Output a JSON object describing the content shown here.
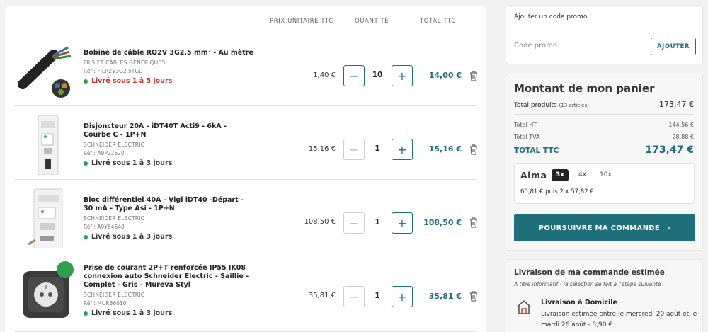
{
  "cart": {
    "headers": {
      "unit_price": "PRIX UNITAIRE TTC",
      "quantity": "QUANTITÉ",
      "total": "TOTAL TTC"
    },
    "items": [
      {
        "title": "Bobine de câble RO2V 3G2,5 mm² - Au mètre",
        "brand": "FILS ET CÂBLES GÉNÉRIQUES",
        "ref": "Réf : FILR2V3G2,5TGL",
        "delivery": "Livré sous 1 à 5 jours",
        "unit_price": "1,40 €",
        "qty": "10",
        "line_total": "14,00 €"
      },
      {
        "title": "Disjoncteur 20A - iDT40T Acti9 - 6kA - Courbe C - 1P+N",
        "brand": "SCHNEIDER ELECTRIC",
        "ref": "Réf : A9P22620",
        "delivery": "Livré sous 1 à 3 jours",
        "unit_price": "15,16 €",
        "qty": "1",
        "line_total": "15,16 €"
      },
      {
        "title": "Bloc différentiel 40A - Vigi iDT40 -Départ - 30 mA - Type Asi - 1P+N",
        "brand": "SCHNEIDER ELECTRIC",
        "ref": "Réf : A9Y64640",
        "delivery": "Livré sous 1 à 3 jours",
        "unit_price": "108,50 €",
        "qty": "1",
        "line_total": "108,50 €"
      },
      {
        "title": "Prise de courant 2P+T renforcée IP55 IK08 connexion auto Schneider Electric - Saillie - Complet - Gris - Mureva Styl",
        "brand": "SCHNEIDER ELECTRIC",
        "ref": "Réf : MUR36010",
        "delivery": "Livré sous 1 à 3 jours",
        "unit_price": "35,81 €",
        "qty": "1",
        "line_total": "35,81 €"
      }
    ]
  },
  "promo": {
    "label": "Ajouter un code promo :",
    "placeholder": "Code promo",
    "button": "AJOUTER"
  },
  "summary": {
    "title": "Montant de mon panier",
    "products_label": "Total produits",
    "products_count": "(13 articles)",
    "products_value": "173,47 €",
    "ht_label": "Total HT",
    "ht_value": "144,56 €",
    "tva_label": "Total TVA",
    "tva_value": "28,88 €",
    "ttc_label": "TOTAL TTC",
    "ttc_value": "173,47 €",
    "alma": {
      "logo": "Alma",
      "options": [
        "3x",
        "4x",
        "10x"
      ],
      "selected": "3x",
      "detail": "60,81 € puis 2 x 57,82 €"
    },
    "checkout": "POURSUIVRE MA COMMANDE"
  },
  "shipping": {
    "title": "Livraison de ma commande estimée",
    "note": "A titre informatif - la sélection se fait à l'étape suivante",
    "method": "Livraison à Domicile",
    "detail": "Livraison estimée entre le mercredi 20 août et le mardi 26 août - 8,90 €"
  },
  "colors": {
    "accent": "#1f6f7a",
    "in_stock_dot": "#2e9e4f",
    "delivery_delayed": "#d0312d"
  }
}
